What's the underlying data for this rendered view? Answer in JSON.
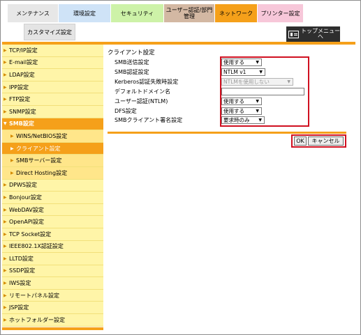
{
  "tabs": [
    {
      "label": "メンテナンス",
      "bg": "#e7e7e7",
      "width": 73
    },
    {
      "label": "環境設定",
      "bg": "#cfe3f7",
      "width": 75
    },
    {
      "label": "セキュリティ",
      "bg": "#cdf2a8",
      "width": 76
    },
    {
      "label": "ユーザー認証/部門管理",
      "bg": "#d3b8a3",
      "width": 73
    },
    {
      "label": "ネットワーク",
      "bg": "#f5a01a",
      "width": 61
    },
    {
      "label": "プリンター設定",
      "bg": "#f7c7d9",
      "width": 66
    }
  ],
  "subtab": {
    "label": "カスタマイズ設定"
  },
  "top_menu": {
    "label": "トップメニューへ"
  },
  "sidebar": {
    "items": [
      {
        "label": "TCP/IP設定",
        "type": "main"
      },
      {
        "label": "E-mail設定",
        "type": "main"
      },
      {
        "label": "LDAP設定",
        "type": "main"
      },
      {
        "label": "IPP設定",
        "type": "main"
      },
      {
        "label": "FTP設定",
        "type": "main"
      },
      {
        "label": "SNMP設定",
        "type": "main"
      },
      {
        "label": "SMB設定",
        "type": "active"
      },
      {
        "label": "WINS/NetBIOS設定",
        "type": "sub"
      },
      {
        "label": "クライアント設定",
        "type": "current"
      },
      {
        "label": "SMBサーバー設定",
        "type": "sub"
      },
      {
        "label": "Direct Hosting設定",
        "type": "sub"
      },
      {
        "label": "DPWS設定",
        "type": "main"
      },
      {
        "label": "Bonjour設定",
        "type": "main"
      },
      {
        "label": "WebDAV設定",
        "type": "main"
      },
      {
        "label": "OpenAPI設定",
        "type": "main"
      },
      {
        "label": "TCP Socket設定",
        "type": "main"
      },
      {
        "label": "IEEE802.1X認証設定",
        "type": "main"
      },
      {
        "label": "LLTD設定",
        "type": "main"
      },
      {
        "label": "SSDP設定",
        "type": "main"
      },
      {
        "label": "IWS設定",
        "type": "main"
      },
      {
        "label": "リモートパネル設定",
        "type": "main"
      },
      {
        "label": "JSP設定",
        "type": "main"
      },
      {
        "label": "ホットフォルダー設定",
        "type": "main"
      }
    ]
  },
  "main": {
    "title": "クライアント設定",
    "fields": [
      {
        "label": "SMB送信設定",
        "kind": "select",
        "value": "使用する",
        "width": 58
      },
      {
        "label": "SMB認証設定",
        "kind": "select",
        "value": "NTLM v1",
        "width": 63
      },
      {
        "label": "Kerberos認証失敗時設定",
        "kind": "select-disabled",
        "value": "NTLMを使用しない",
        "width": 103
      },
      {
        "label": "デフォルトドメイン名",
        "kind": "text",
        "value": ""
      },
      {
        "label": "ユーザー認証(NTLM)",
        "kind": "select",
        "value": "使用する",
        "width": 58
      },
      {
        "label": "DFS設定",
        "kind": "select",
        "value": "使用する",
        "width": 58
      },
      {
        "label": "SMBクライアント署名設定",
        "kind": "select",
        "value": "要求時のみ",
        "width": 62
      }
    ],
    "ok_label": "OK",
    "cancel_label": "キャンセル"
  },
  "colors": {
    "accent": "#f5a01a",
    "highlight": "#d01020",
    "sidebar_bg": "#fff5a8"
  }
}
